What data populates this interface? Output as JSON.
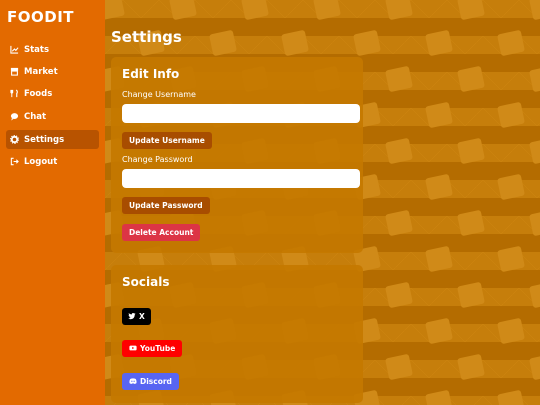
{
  "app": {
    "logo": "FOODIT"
  },
  "sidebar": {
    "items": [
      {
        "label": "Stats",
        "icon": "chart-line-icon"
      },
      {
        "label": "Market",
        "icon": "store-icon"
      },
      {
        "label": "Foods",
        "icon": "utensils-icon"
      },
      {
        "label": "Chat",
        "icon": "chat-bubble-icon"
      },
      {
        "label": "Settings",
        "icon": "gear-icon",
        "active": true
      },
      {
        "label": "Logout",
        "icon": "logout-icon"
      }
    ]
  },
  "main": {
    "title": "Settings",
    "edit_info": {
      "title": "Edit Info",
      "username_label": "Change Username",
      "username_value": "",
      "update_username": "Update Username",
      "password_label": "Change Password",
      "password_value": "",
      "update_password": "Update Password",
      "delete_account": "Delete Account"
    },
    "socials": {
      "title": "Socials",
      "x_label": "X",
      "youtube_label": "YouTube",
      "discord_label": "Discord"
    }
  },
  "colors": {
    "sidebar": "#e36a00",
    "active_nav": "#b85300",
    "card": "#c47800",
    "button_brown": "#a84d00",
    "danger": "#dc3545",
    "youtube": "#ff0000",
    "discord": "#5865f2"
  }
}
